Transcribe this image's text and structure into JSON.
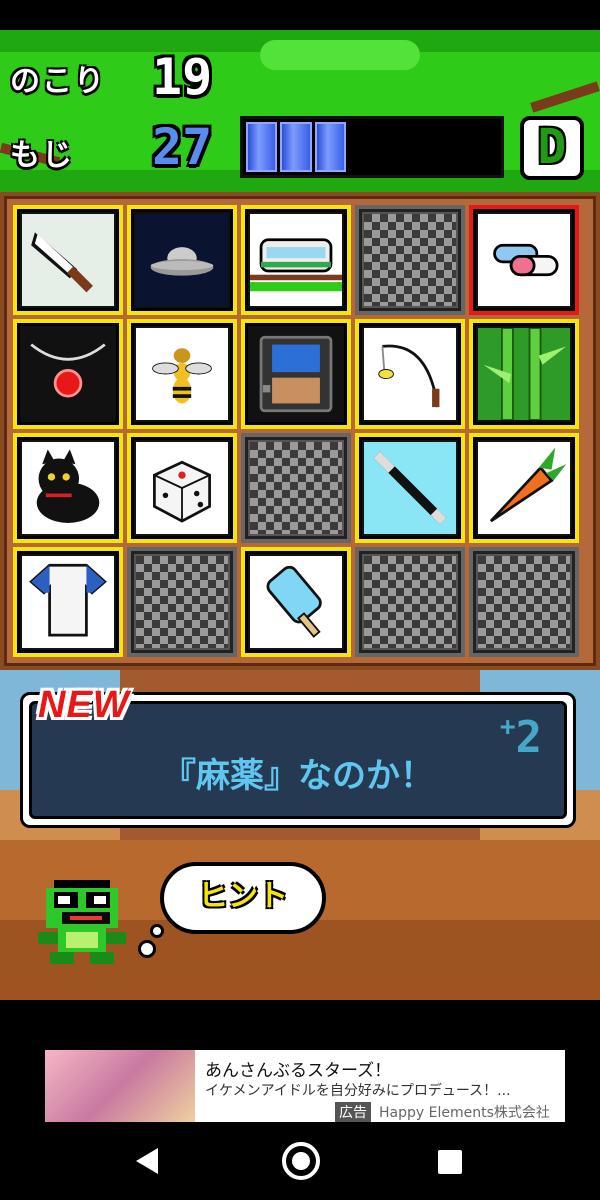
{
  "hud": {
    "remaining_label": "のこり",
    "remaining_value": "19",
    "chars_label": "もじ",
    "chars_value": "27",
    "gauge_filled": 3,
    "gauge_total": 8,
    "rank": "D"
  },
  "board": {
    "rows": 4,
    "cols": 5,
    "tiles": [
      {
        "icon": "knife-icon",
        "state": "revealed"
      },
      {
        "icon": "ufo-icon",
        "state": "revealed"
      },
      {
        "icon": "train-icon",
        "state": "revealed"
      },
      {
        "icon": "locked-tile",
        "state": "locked"
      },
      {
        "icon": "capsule-pill-icon",
        "state": "selected"
      },
      {
        "icon": "pendant-necklace-icon",
        "state": "revealed"
      },
      {
        "icon": "wasp-icon",
        "state": "revealed"
      },
      {
        "icon": "game-console-icon",
        "state": "revealed"
      },
      {
        "icon": "fishing-rod-icon",
        "state": "revealed"
      },
      {
        "icon": "bamboo-icon",
        "state": "revealed"
      },
      {
        "icon": "black-cat-icon",
        "state": "revealed"
      },
      {
        "icon": "dice-icon",
        "state": "revealed"
      },
      {
        "icon": "locked-tile",
        "state": "locked"
      },
      {
        "icon": "stick-icon",
        "state": "revealed"
      },
      {
        "icon": "carrot-icon",
        "state": "revealed"
      },
      {
        "icon": "shirt-icon",
        "state": "revealed"
      },
      {
        "icon": "locked-tile",
        "state": "locked"
      },
      {
        "icon": "popsicle-icon",
        "state": "revealed"
      },
      {
        "icon": "locked-tile",
        "state": "locked"
      },
      {
        "icon": "locked-tile",
        "state": "locked"
      }
    ]
  },
  "message": {
    "new_label": "NEW",
    "text": "『麻薬』なのか！",
    "plus_sign": "+",
    "plus_value": "2"
  },
  "hint": {
    "label": "ヒント"
  },
  "ad": {
    "title": "あんさんぶるスターズ！",
    "description": "イケメンアイドルを自分好みにプロデュース！...",
    "tag": "広告",
    "advertiser": "Happy Elements株式会社"
  },
  "colors": {
    "canopy": "#2ecc18",
    "tile_border": "#f5e50a",
    "selected_border": "#e81818",
    "message_text": "#5fc7ef"
  }
}
